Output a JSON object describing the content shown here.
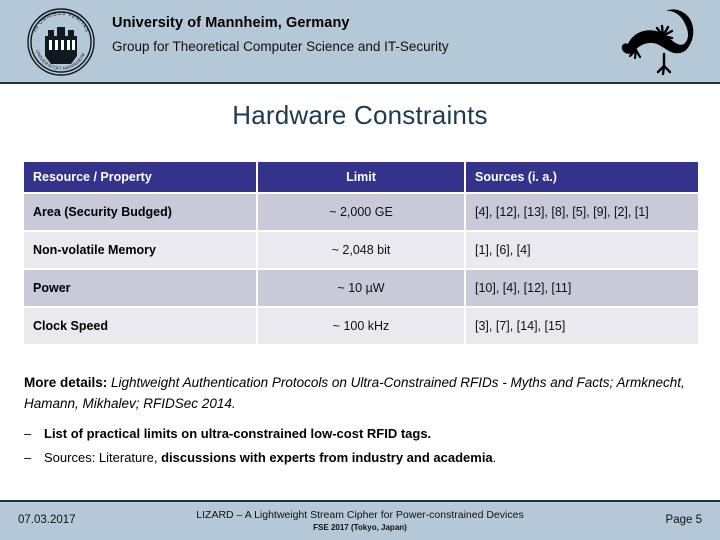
{
  "header": {
    "organization": "University of Mannheim, Germany",
    "group": "Group for Theoretical Computer Science and IT-Security",
    "crest_icon": "university-crest-icon",
    "crest_motto_top": "IN OMNIBUS VERITAS",
    "crest_motto_bottom": "UNIVERSITÄT MANNHEIM",
    "logo_icon": "lizard-logo-icon",
    "band_color": "#b4c8d7"
  },
  "slide": {
    "title": "Hardware Constraints",
    "title_color": "#1e3a4f"
  },
  "table": {
    "header_bg": "#33338c",
    "row_odd_bg": "#c9c9da",
    "row_even_bg": "#e9e9ef",
    "columns": [
      "Resource / Property",
      "Limit",
      "Sources (i. a.)"
    ],
    "rows": [
      {
        "resource": "Area (Security Budged)",
        "limit": "~ 2,000 GE",
        "sources": "[4], [12], [13], [8], [5], [9], [2], [1]"
      },
      {
        "resource": "Non-volatile Memory",
        "limit": "~ 2,048 bit",
        "sources": "[1], [6], [4]"
      },
      {
        "resource": "Power",
        "limit": "~ 10 µW",
        "sources": "[10], [4], [12], [11]"
      },
      {
        "resource": "Clock Speed",
        "limit": "~ 100 kHz",
        "sources": "[3], [7], [14], [15]"
      }
    ]
  },
  "more_details": {
    "label": "More details:",
    "reference": " Lightweight Authentication Protocols on Ultra-Constrained RFIDs - Myths and Facts; Armknecht, Hamann, Mikhalev; RFIDSec 2014."
  },
  "bullets": [
    {
      "marker": "–",
      "bold_part": "List of practical limits on ultra-constrained low-cost RFID tags.",
      "normal_part": ""
    },
    {
      "marker": "–",
      "normal_part": "Sources: Literature, ",
      "bold_part": "discussions with experts from industry and academia",
      "tail": "."
    }
  ],
  "footer": {
    "date": "07.03.2017",
    "talk_title": "LIZARD – A Lightweight Stream Cipher for Power-constrained Devices",
    "venue": "FSE 2017 (Tokyo, Japan)",
    "page": "Page 5",
    "band_color": "#b4c8d7"
  }
}
